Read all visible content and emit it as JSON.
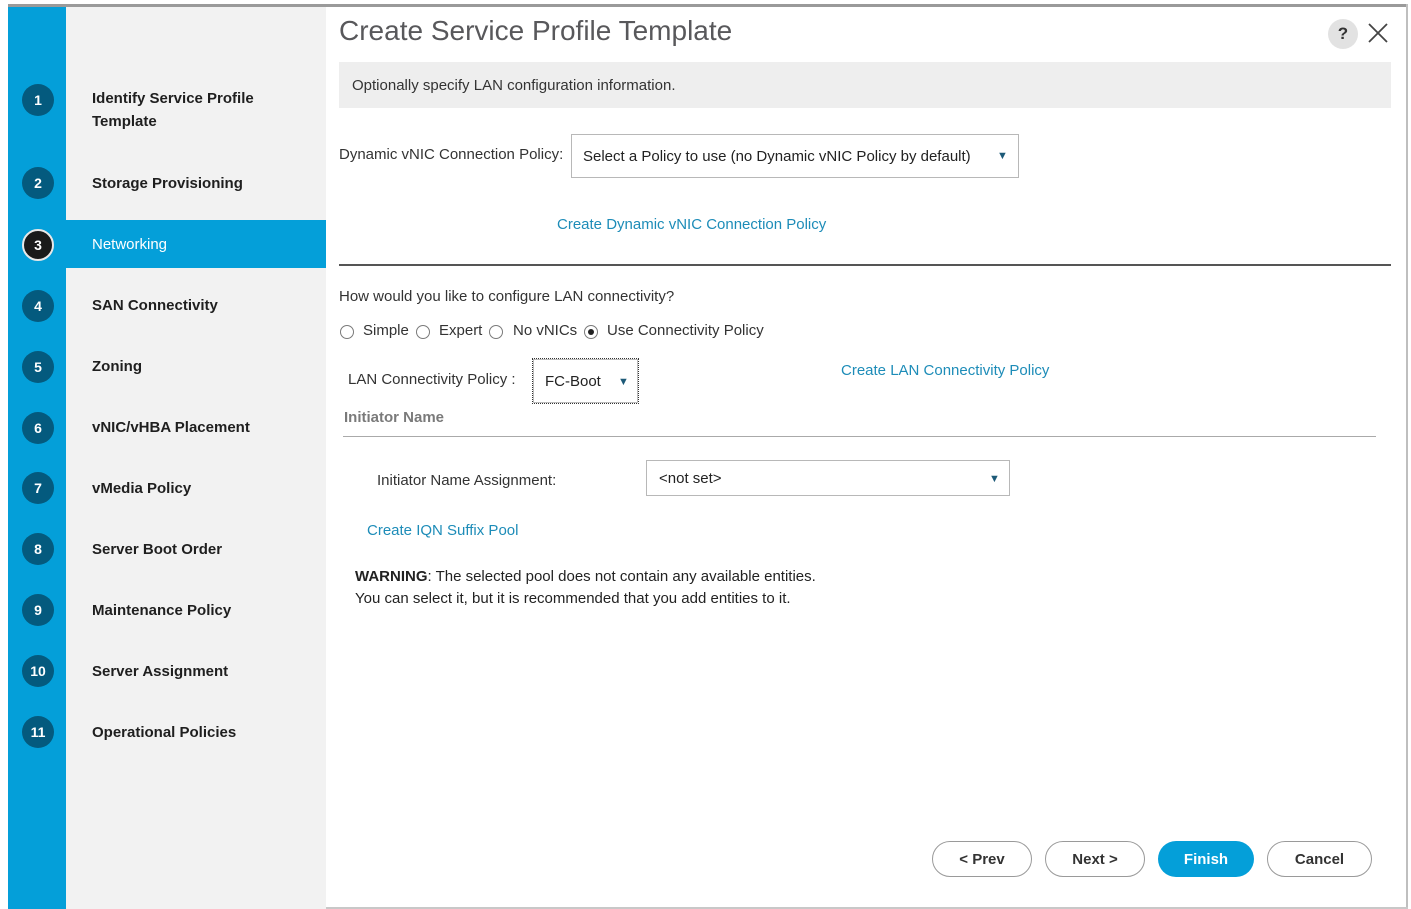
{
  "window": {
    "title": "Create Service Profile Template",
    "help_label": "?",
    "close_icon": "close-icon"
  },
  "colors": {
    "accent": "#049fd9",
    "link": "#1d8cb8",
    "step_badge": "#045a7e",
    "sidebar_bg": "#f2f2f2"
  },
  "steps": [
    {
      "num": "1",
      "label": "Identify Service Profile Template"
    },
    {
      "num": "2",
      "label": "Storage Provisioning"
    },
    {
      "num": "3",
      "label": "Networking"
    },
    {
      "num": "4",
      "label": "SAN Connectivity"
    },
    {
      "num": "5",
      "label": "Zoning"
    },
    {
      "num": "6",
      "label": "vNIC/vHBA Placement"
    },
    {
      "num": "7",
      "label": "vMedia Policy"
    },
    {
      "num": "8",
      "label": "Server Boot Order"
    },
    {
      "num": "9",
      "label": "Maintenance Policy"
    },
    {
      "num": "10",
      "label": "Server Assignment"
    },
    {
      "num": "11",
      "label": "Operational Policies"
    }
  ],
  "active_step": "3",
  "info": "Optionally specify LAN configuration information.",
  "dynamic_vnic": {
    "label": "Dynamic vNIC Connection Policy:",
    "selected": "Select a Policy to use (no Dynamic vNIC Policy by default)",
    "create_link": "Create Dynamic vNIC Connection Policy"
  },
  "lan": {
    "question": "How would you like to configure LAN connectivity?",
    "options": [
      {
        "label": "Simple",
        "checked": false
      },
      {
        "label": "Expert",
        "checked": false
      },
      {
        "label": "No vNICs",
        "checked": false
      },
      {
        "label": "Use Connectivity Policy",
        "checked": true
      }
    ],
    "policy_label": "LAN Connectivity Policy :",
    "policy_selected": "FC-Boot",
    "create_link": "Create LAN Connectivity Policy"
  },
  "initiator": {
    "heading": "Initiator Name",
    "assignment_label": "Initiator Name Assignment:",
    "assignment_selected": "<not set>",
    "create_link": "Create IQN Suffix Pool",
    "warning_bold": "WARNING",
    "warning_line1": ": The selected pool does not contain any available entities.",
    "warning_line2": "You can select it, but it is recommended that you add entities to it."
  },
  "buttons": {
    "prev": "< Prev",
    "next": "Next >",
    "finish": "Finish",
    "cancel": "Cancel"
  }
}
